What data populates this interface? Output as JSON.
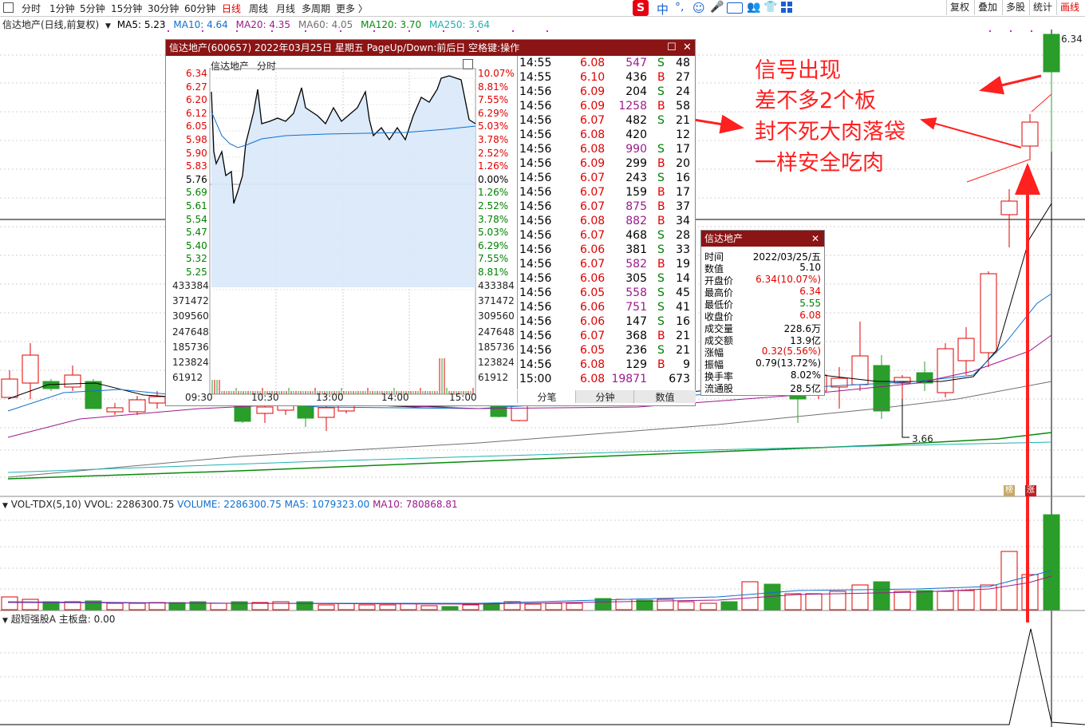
{
  "toolbar": {
    "tabs": [
      "分时",
      "1分钟",
      "5分钟",
      "15分钟",
      "30分钟",
      "60分钟",
      "日线",
      "周线",
      "月线",
      "多周期",
      "更多 〉"
    ],
    "active_tab": "日线",
    "ime_label": "中",
    "right_buttons": [
      "复权",
      "叠加",
      "多股",
      "统计",
      "画线"
    ],
    "active_right": "画线"
  },
  "ma_header": {
    "title": "信达地产(日线,前复权)",
    "ma5": "MA5: 5.23",
    "ma10": "MA10: 4.64",
    "ma20": "MA20: 4.35",
    "ma60": "MA60: 4.05",
    "ma120": "MA120: 3.70",
    "ma250": "MA250: 3.64",
    "colors": {
      "ma5": "#000000",
      "ma10": "#1070d0",
      "ma20": "#9b1a8c",
      "ma60": "#707070",
      "ma120": "#0a8a0a",
      "ma250": "#20b0b0"
    }
  },
  "main_chart": {
    "price_label_top": "6.34",
    "low_label": "3.66",
    "tag1": "榜",
    "tag2": "涨"
  },
  "vol_header": {
    "title": "VOL-TDX(5,10)",
    "vvol": "VVOL: 2286300.75",
    "volume": "VOLUME: 2286300.75",
    "ma5": "MA5: 1079323.00",
    "ma10": "MA10: 780868.81"
  },
  "ind_header": {
    "title": "超短强股A",
    "value": "主板盘: 0.00"
  },
  "popup": {
    "title": "信达地产(600657) 2022年03月25日 星期五 PageUp/Down:前后日 空格键:操作",
    "stock_name": "信达地产",
    "mode": "分时",
    "left_prices": [
      "6.34",
      "6.27",
      "6.20",
      "6.12",
      "6.05",
      "5.98",
      "5.90",
      "5.83",
      "5.76",
      "5.69",
      "5.61",
      "5.54",
      "5.47",
      "5.40",
      "5.32",
      "5.25"
    ],
    "right_pcts": [
      "10.07%",
      "8.81%",
      "7.55%",
      "6.29%",
      "5.03%",
      "3.78%",
      "2.52%",
      "1.26%",
      "0.00%",
      "1.26%",
      "2.52%",
      "3.78%",
      "5.03%",
      "6.29%",
      "7.55%",
      "8.81%"
    ],
    "vol_labels": [
      "433384",
      "371472",
      "309560",
      "247648",
      "185736",
      "123824",
      "61912"
    ],
    "time_labels": [
      "09:30",
      "10:30",
      "13:00",
      "14:00",
      "15:00"
    ],
    "trades": [
      {
        "time": "14:55",
        "price": "6.08",
        "vol": "547",
        "side": "S",
        "n": "48"
      },
      {
        "time": "14:55",
        "price": "6.10",
        "vol": "436",
        "side": "B",
        "n": "27"
      },
      {
        "time": "14:56",
        "price": "6.09",
        "vol": "204",
        "side": "S",
        "n": "24"
      },
      {
        "time": "14:56",
        "price": "6.09",
        "vol": "1258",
        "side": "B",
        "n": "58"
      },
      {
        "time": "14:56",
        "price": "6.07",
        "vol": "482",
        "side": "S",
        "n": "21"
      },
      {
        "time": "14:56",
        "price": "6.08",
        "vol": "420",
        "side": "",
        "n": "12"
      },
      {
        "time": "14:56",
        "price": "6.08",
        "vol": "990",
        "side": "S",
        "n": "17"
      },
      {
        "time": "14:56",
        "price": "6.09",
        "vol": "299",
        "side": "B",
        "n": "20"
      },
      {
        "time": "14:56",
        "price": "6.07",
        "vol": "243",
        "side": "S",
        "n": "16"
      },
      {
        "time": "14:56",
        "price": "6.07",
        "vol": "159",
        "side": "B",
        "n": "17"
      },
      {
        "time": "14:56",
        "price": "6.07",
        "vol": "875",
        "side": "B",
        "n": "37"
      },
      {
        "time": "14:56",
        "price": "6.08",
        "vol": "882",
        "side": "B",
        "n": "34"
      },
      {
        "time": "14:56",
        "price": "6.07",
        "vol": "468",
        "side": "S",
        "n": "28"
      },
      {
        "time": "14:56",
        "price": "6.06",
        "vol": "381",
        "side": "S",
        "n": "33"
      },
      {
        "time": "14:56",
        "price": "6.07",
        "vol": "582",
        "side": "B",
        "n": "19"
      },
      {
        "time": "14:56",
        "price": "6.06",
        "vol": "305",
        "side": "S",
        "n": "14"
      },
      {
        "time": "14:56",
        "price": "6.05",
        "vol": "558",
        "side": "S",
        "n": "45"
      },
      {
        "time": "14:56",
        "price": "6.06",
        "vol": "751",
        "side": "S",
        "n": "41"
      },
      {
        "time": "14:56",
        "price": "6.06",
        "vol": "147",
        "side": "S",
        "n": "16"
      },
      {
        "time": "14:56",
        "price": "6.07",
        "vol": "368",
        "side": "B",
        "n": "21"
      },
      {
        "time": "14:56",
        "price": "6.05",
        "vol": "236",
        "side": "S",
        "n": "21"
      },
      {
        "time": "14:56",
        "price": "6.08",
        "vol": "129",
        "side": "B",
        "n": "9"
      },
      {
        "time": "15:00",
        "price": "6.08",
        "vol": "19871",
        "side": "",
        "n": "673"
      }
    ],
    "tabs": [
      "分笔",
      "分钟",
      "数值"
    ]
  },
  "infobox": {
    "title": "信达地产",
    "rows": [
      {
        "k": "时间",
        "v": "2022/03/25/五",
        "c": "#000000"
      },
      {
        "k": "数值",
        "v": "5.10",
        "c": "#000000"
      },
      {
        "k": "开盘价",
        "v": "6.34(10.07%)",
        "c": "#e00000"
      },
      {
        "k": "最高价",
        "v": "6.34",
        "c": "#e00000"
      },
      {
        "k": "最低价",
        "v": "5.55",
        "c": "#008000"
      },
      {
        "k": "收盘价",
        "v": "6.08",
        "c": "#e00000"
      },
      {
        "k": "成交量",
        "v": "228.6万",
        "c": "#000000"
      },
      {
        "k": "成交额",
        "v": "13.9亿",
        "c": "#000000"
      },
      {
        "k": "涨幅",
        "v": "0.32(5.56%)",
        "c": "#e00000"
      },
      {
        "k": "振幅",
        "v": "0.79(13.72%)",
        "c": "#000000"
      },
      {
        "k": "换手率",
        "v": "8.02%",
        "c": "#000000"
      },
      {
        "k": "流通股",
        "v": "28.5亿",
        "c": "#000000"
      }
    ]
  },
  "annotations": [
    "信号出现",
    "差不多2个板",
    "封不死大肉落袋",
    "一样安全吃肉"
  ]
}
